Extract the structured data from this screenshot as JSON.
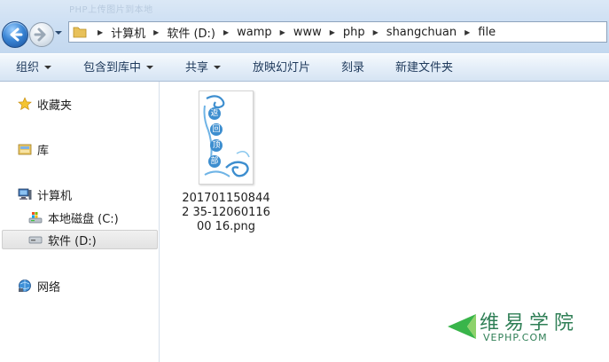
{
  "window": {
    "ghost_title": "PHP上传图片到本地"
  },
  "address": {
    "breadcrumbs": [
      "计算机",
      "软件 (D:)",
      "wamp",
      "www",
      "php",
      "shangchuan",
      "file"
    ]
  },
  "toolbar": {
    "organize": "组织",
    "include_in_library": "包含到库中",
    "share": "共享",
    "slideshow": "放映幻灯片",
    "burn": "刻录",
    "new_folder": "新建文件夹"
  },
  "navpane": {
    "favorites": "收藏夹",
    "libraries": "库",
    "computer": "计算机",
    "local_disk_c": "本地磁盘 (C:)",
    "software_d": "软件 (D:)",
    "network": "网络"
  },
  "files": [
    {
      "name": "2017011508442 35-1206011600 16.png",
      "thumb_chars": [
        "返",
        "回",
        "顶",
        "部"
      ]
    }
  ],
  "watermark": {
    "brand": "维易学院",
    "domain": "VEPHP.COM"
  },
  "colors": {
    "accent": "#3d8ecf",
    "selection": "#e2e2e2",
    "watermark": "#2f7f56"
  },
  "icons": {
    "back": "back-arrow-icon",
    "forward": "forward-arrow-icon",
    "folder": "folder-icon",
    "star": "star-icon",
    "library": "library-icon",
    "computer": "computer-icon",
    "drive": "drive-icon",
    "network": "network-icon"
  }
}
